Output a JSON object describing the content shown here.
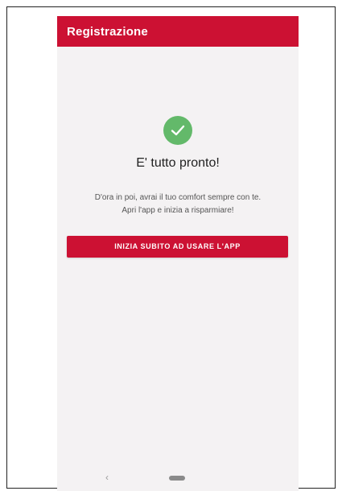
{
  "app_bar": {
    "title": "Registrazione"
  },
  "success": {
    "icon": "check-circle-icon",
    "headline": "E' tutto pronto!",
    "message": "D'ora in poi, avrai il tuo comfort sempre con te. Apri l'app e inizia a risparmiare!"
  },
  "actions": {
    "start_button_label": "INIZIA SUBITO AD USARE L'APP"
  },
  "system_nav": {
    "back_icon": "back-chevron-icon",
    "back_glyph": "‹",
    "home_icon": "home-pill-icon"
  },
  "colors": {
    "brand_red": "#cc1133",
    "success_green": "#63b96a",
    "background": "#f4f2f3"
  }
}
